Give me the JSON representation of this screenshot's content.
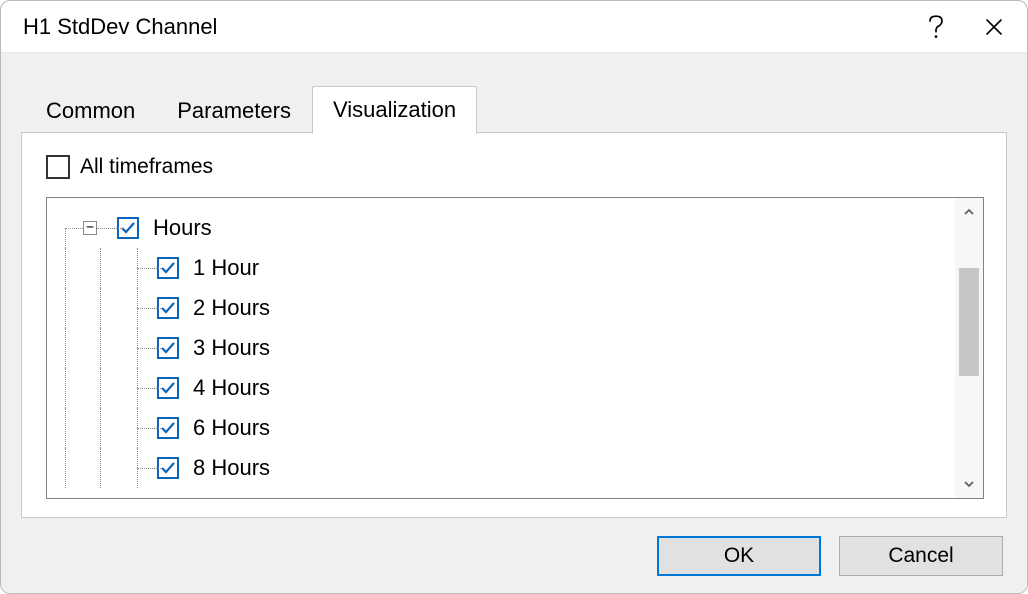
{
  "window": {
    "title": "H1 StdDev Channel"
  },
  "tabs": [
    {
      "label": "Common",
      "active": false
    },
    {
      "label": "Parameters",
      "active": false
    },
    {
      "label": "Visualization",
      "active": true
    }
  ],
  "allTimeframes": {
    "label": "All timeframes",
    "checked": false
  },
  "tree": {
    "group": {
      "label": "Hours",
      "expanded": true,
      "checked": true,
      "children": [
        {
          "label": "1 Hour",
          "checked": true
        },
        {
          "label": "2 Hours",
          "checked": true
        },
        {
          "label": "3 Hours",
          "checked": true
        },
        {
          "label": "4 Hours",
          "checked": true
        },
        {
          "label": "6 Hours",
          "checked": true
        },
        {
          "label": "8 Hours",
          "checked": true
        }
      ]
    }
  },
  "buttons": {
    "ok": "OK",
    "cancel": "Cancel"
  },
  "glyphs": {
    "minus": "−"
  }
}
